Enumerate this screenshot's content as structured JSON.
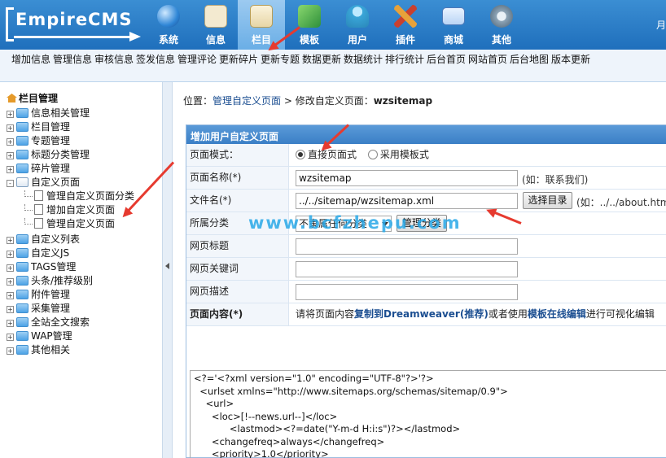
{
  "logo": {
    "text": "EmpireCMS"
  },
  "topnav": [
    {
      "label": "系统",
      "icon": "globe-icon",
      "color": "#2f86d6"
    },
    {
      "label": "信息",
      "icon": "notepad-icon",
      "color": "#e9d9a6"
    },
    {
      "label": "栏目",
      "icon": "folder-icon",
      "color": "#f1e6c9",
      "active": true
    },
    {
      "label": "模板",
      "icon": "template-icon",
      "color": "#6fc36a"
    },
    {
      "label": "用户",
      "icon": "user-icon",
      "color": "#57c2e6"
    },
    {
      "label": "插件",
      "icon": "tools-icon",
      "color": "#e8a23a"
    },
    {
      "label": "商城",
      "icon": "card-icon",
      "color": "#5b86c4"
    },
    {
      "label": "其他",
      "icon": "gear-icon",
      "color": "#9db4c7"
    }
  ],
  "topright": "月",
  "subnav": [
    "增加信息",
    "管理信息",
    "审核信息",
    "签发信息",
    "管理评论",
    "更新碎片",
    "更新专题",
    "数据更新",
    "数据统计",
    "排行统计",
    "后台首页",
    "网站首页",
    "后台地图",
    "版本更新"
  ],
  "tree": {
    "title": "栏目管理",
    "items": [
      {
        "label": "信息相关管理",
        "box": "+"
      },
      {
        "label": "栏目管理",
        "box": "+"
      },
      {
        "label": "专题管理",
        "box": "+"
      },
      {
        "label": "标题分类管理",
        "box": "+"
      },
      {
        "label": "碎片管理",
        "box": "+"
      },
      {
        "label": "自定义页面",
        "box": "-"
      },
      {
        "label": "管理自定义页面分类",
        "child": true
      },
      {
        "label": "增加自定义页面",
        "child": true
      },
      {
        "label": "管理自定义页面",
        "child": true
      },
      {
        "label": "自定义列表",
        "box": "+"
      },
      {
        "label": "自定义JS",
        "box": "+"
      },
      {
        "label": "TAGS管理",
        "box": "+"
      },
      {
        "label": "头条/推荐级别",
        "box": "+"
      },
      {
        "label": "附件管理",
        "box": "+"
      },
      {
        "label": "采集管理",
        "box": "+"
      },
      {
        "label": "全站全文搜索",
        "box": "+"
      },
      {
        "label": "WAP管理",
        "box": "+"
      },
      {
        "label": "其他相关",
        "box": "+"
      }
    ]
  },
  "breadcrumb": {
    "prefix": "位置：",
    "link": "管理自定义页面",
    "sep": " > 修改自定义页面：",
    "current": "wzsitemap"
  },
  "form": {
    "header": "增加用户自定义页面",
    "mode_label": "页面模式：",
    "mode_direct": "直接页面式",
    "mode_template": "采用模板式",
    "name_label": "页面名称(*)",
    "name_value": "wzsitemap",
    "name_hint": "(如：联系我们)",
    "file_label": "文件名(*)",
    "file_value": "../../sitemap/wzsitemap.xml",
    "file_button": "选择目录",
    "file_hint": "(如：../../about.html",
    "cat_label": "所属分类",
    "cat_value": "不隶属任何分类",
    "cat_button": "管理分类",
    "title_label": "网页标题",
    "keywords_label": "网页关键词",
    "desc_label": "网页描述",
    "content_label": "页面内容(*)",
    "content_hint_a": "请将页面内容",
    "content_hint_b": "复制到Dreamweaver(推荐)",
    "content_hint_c": "或者使用",
    "content_hint_d": "模板在线编辑",
    "content_hint_e": "进行可视化编辑",
    "code": "<?='<?xml version=\"1.0\" encoding=\"UTF-8\"?>'?>\n  <urlset xmlns=\"http://www.sitemaps.org/schemas/sitemap/0.9\">\n    <url>\n      <loc>[!--news.url--]</loc>\n            <lastmod><?=date(\"Y-m-d H:i:s\")?></lastmod>\n      <changefreq>always</changefreq>\n      <priority>1.0</priority>\n    </url>\n    <url>\n      <loc>[!--news.url--]jiaocheng/</loc>\n            <lastmod><?=date(\"Y-m-d H:i:s\")?></lastmod>"
  },
  "watermark": "www.bcfzhepu.com"
}
